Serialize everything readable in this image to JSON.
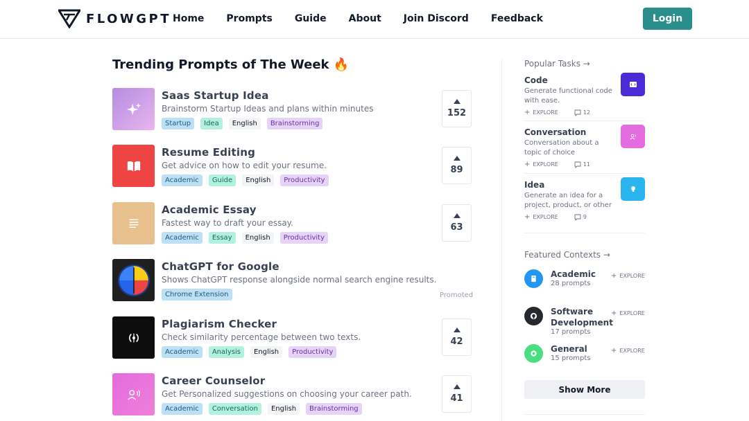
{
  "header": {
    "logo_text": "FLOWGPT",
    "nav": [
      "Home",
      "Prompts",
      "Guide",
      "About",
      "Join Discord",
      "Feedback"
    ],
    "login_label": "Login"
  },
  "main": {
    "title": "Trending Prompts of The Week 🔥",
    "prompts": [
      {
        "title": "Saas Startup Idea",
        "desc": "Brainstorm Startup Ideas and plans within minutes",
        "tags": [
          "Startup",
          "Idea",
          "English",
          "Brainstorming"
        ],
        "votes": "152",
        "icon": "sparkles-icon"
      },
      {
        "title": "Resume Editing",
        "desc": "Get advice on how to edit your resume.",
        "tags": [
          "Academic",
          "Guide",
          "English",
          "Productivity"
        ],
        "votes": "89",
        "icon": "book-icon"
      },
      {
        "title": "Academic Essay",
        "desc": "Fastest way to draft your essay.",
        "tags": [
          "Academic",
          "Essay",
          "English",
          "Productivity"
        ],
        "votes": "63",
        "icon": "document-icon"
      },
      {
        "title": "ChatGPT for Google",
        "desc": "Shows ChatGPT response alongside normal search engine results.",
        "tags": [
          "Chrome Extension"
        ],
        "promoted_label": "Promoted",
        "icon": "brain-icon"
      },
      {
        "title": "Plagiarism Checker",
        "desc": "Check similarity percentage between two texts.",
        "tags": [
          "Academic",
          "Analysis",
          "English",
          "Productivity"
        ],
        "votes": "42",
        "icon": "compare-icon"
      },
      {
        "title": "Career Counselor",
        "desc": "Get Personalized suggestions on choosing your career path.",
        "tags": [
          "Academic",
          "Conversation",
          "English",
          "Brainstorming"
        ],
        "votes": "41",
        "icon": "speaking-person-icon"
      }
    ]
  },
  "sidebar": {
    "popular_tasks_label": "Popular Tasks →",
    "tasks": [
      {
        "title": "Code",
        "desc": "Generate functional code with ease.",
        "explore": "EXPLORE",
        "comments": "12",
        "color": "#4b2bd6"
      },
      {
        "title": "Conversation",
        "desc": "Conversation about a topic of choice",
        "explore": "EXPLORE",
        "comments": "11",
        "color": "#e56be0"
      },
      {
        "title": "Idea",
        "desc": "Generate an idea for a project, product, or other",
        "explore": "EXPLORE",
        "comments": "9",
        "color": "#2bb5ef"
      }
    ],
    "featured_label": "Featured Contexts →",
    "contexts": [
      {
        "title": "Academic",
        "count": "28 prompts",
        "explore": "EXPLORE",
        "color": "#2196f3"
      },
      {
        "title": "Software Development",
        "count": "17 prompts",
        "explore": "EXPLORE",
        "color": "#24292f"
      },
      {
        "title": "General",
        "count": "15 prompts",
        "explore": "EXPLORE",
        "color": "#4ade80"
      }
    ],
    "show_more_label": "Show More"
  }
}
